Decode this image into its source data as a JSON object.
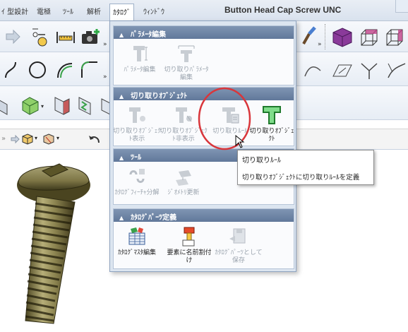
{
  "menubar": {
    "items": [
      "ｲ 型設計",
      "電極",
      "ﾂｰﾙ",
      "解析",
      "ｶﾀﾛｸﾞ",
      "ｳｨﾝﾄﾞｳ"
    ],
    "active_index": 4,
    "title": "Button Head Cap Screw UNC"
  },
  "dropdown": {
    "sections": [
      {
        "title": "ﾊﾟﾗﾒｰﾀ編集",
        "tools": [
          {
            "label": "ﾊﾟﾗﾒｰﾀ編集",
            "enabled": false,
            "icon": "parameter-edit-icon"
          },
          {
            "label": "切り取りﾊﾟﾗﾒｰﾀ編集",
            "enabled": false,
            "icon": "cut-parameter-edit-icon"
          }
        ]
      },
      {
        "title": "切り取りｵﾌﾞｼﾞｪｸﾄ",
        "tools": [
          {
            "label": "切り取りｵﾌﾞｼﾞｪｸﾄ表示",
            "enabled": false,
            "icon": "cut-object-show-icon"
          },
          {
            "label": "切り取りｵﾌﾞｼﾞｪｸﾄ非表示",
            "enabled": false,
            "icon": "cut-object-hide-icon"
          },
          {
            "label": "切り取りﾙｰﾙ",
            "enabled": false,
            "icon": "cut-rule-icon"
          },
          {
            "label": "切り取りｵﾌﾞｼﾞｪｸﾄ",
            "enabled": true,
            "icon": "cut-object-icon"
          }
        ]
      },
      {
        "title": "ﾂｰﾙ",
        "tools": [
          {
            "label": "ｶﾀﾛｸﾞﾌｨｰﾁｬ分解",
            "enabled": false,
            "icon": "catalog-feature-decompose-icon"
          },
          {
            "label": "ｼﾞｵﾒﾄﾘ更新",
            "enabled": false,
            "icon": "geometry-update-icon"
          }
        ]
      },
      {
        "title": "ｶﾀﾛｸﾞﾊﾟｰﾂ定義",
        "tools": [
          {
            "label": "ｶﾀﾛｸﾞﾏｽﾀ編集",
            "enabled": true,
            "icon": "catalog-master-edit-icon"
          },
          {
            "label": "要素に名前割付け",
            "enabled": true,
            "icon": "assign-name-icon"
          },
          {
            "label": "ｶﾀﾛｸﾞﾊﾟｰﾂとして保存",
            "enabled": false,
            "icon": "save-as-catalog-part-icon"
          }
        ]
      }
    ]
  },
  "tooltip": {
    "title": "切り取りﾙｰﾙ",
    "description": "切り取りｵﾌﾞｼﾞｪｸﾄに切り取りﾙｰﾙを定義"
  },
  "colors": {
    "section_header": "#6b82a3",
    "highlight_circle": "#d9363b",
    "enabled_green": "#33b24a"
  }
}
